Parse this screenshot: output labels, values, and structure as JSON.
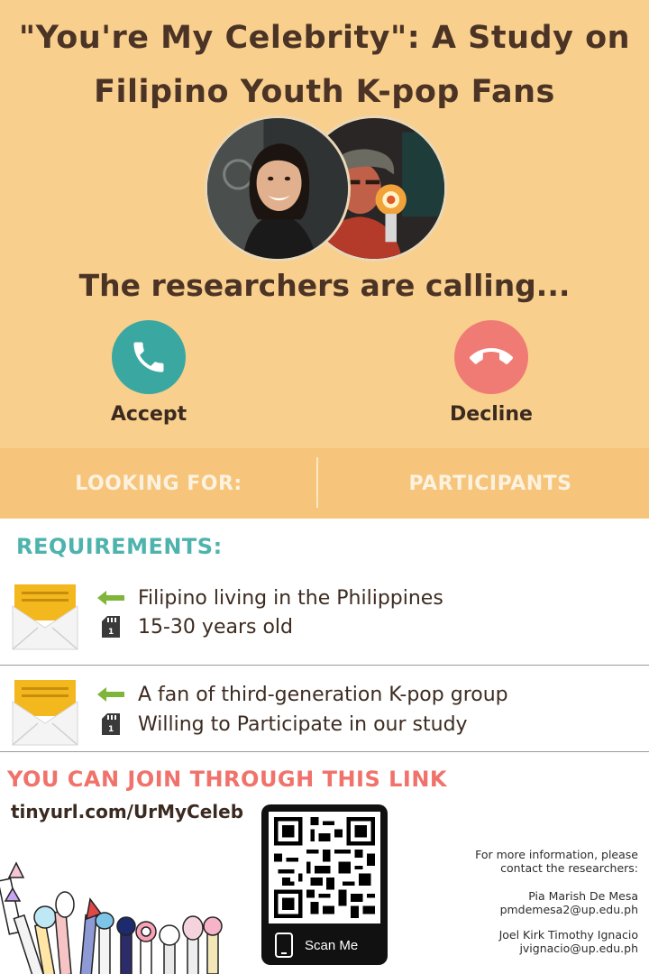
{
  "title": {
    "line1": "\"You're My Celebrity\": A Study on",
    "line2": "Filipino Youth K-pop Fans"
  },
  "call": {
    "status_text": "The researchers are calling...",
    "accept_label": "Accept",
    "decline_label": "Decline",
    "accept_color": "#3ba7a1",
    "decline_color": "#f07b74"
  },
  "band": {
    "left_text": "LOOKING FOR:",
    "right_text": "PARTICIPANTS"
  },
  "requirements": {
    "title": "REQUIREMENTS:",
    "groups": [
      {
        "items": [
          {
            "icon": "arrow-left-icon",
            "text": "Filipino living in the Philippines"
          },
          {
            "icon": "sd-card-icon",
            "text": "15-30 years old"
          }
        ]
      },
      {
        "items": [
          {
            "icon": "arrow-left-icon",
            "text": "A fan of third-generation K-pop group"
          },
          {
            "icon": "sd-card-icon",
            "text": "Willing to Participate in our study"
          }
        ]
      }
    ]
  },
  "join": {
    "title": "YOU CAN JOIN THROUGH THIS LINK",
    "link": "tinyurl.com/UrMyCeleb",
    "qr_label": "Scan Me"
  },
  "contact": {
    "intro_line1": "For more information, please",
    "intro_line2": "contact the researchers:",
    "researchers": [
      {
        "name": "Pia Marish De Mesa",
        "email": "pmdemesa2@up.edu.ph"
      },
      {
        "name": "Joel Kirk Timothy Ignacio",
        "email": "jvignacio@up.edu.ph"
      }
    ]
  },
  "colors": {
    "top_background": "#f9cf8d",
    "band_background": "#f6c47a",
    "requirements_title": "#4fb3ad",
    "join_title": "#f0726b",
    "arrow_green": "#7fb53a"
  }
}
